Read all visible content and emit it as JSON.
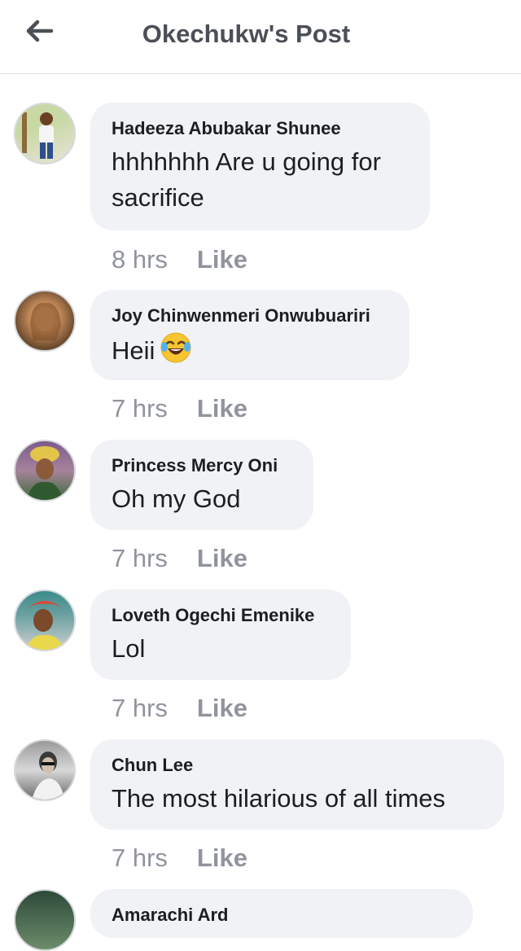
{
  "header": {
    "back_icon": "arrow-left-icon",
    "title": "Okechukw's Post"
  },
  "comments": [
    {
      "author": "Hadeeza Abubakar Shunee",
      "text": "hhhhhhh Are u going for sacrifice",
      "time": "8 hrs",
      "like": "Like",
      "avatar_colors": [
        "#c9d9a6",
        "#e8e3d8"
      ]
    },
    {
      "author": "Joy Chinwenmeri Onwubuariri",
      "text": "Heii",
      "emoji": "face-with-tears-of-joy-icon",
      "time": "7 hrs",
      "like": "Like",
      "avatar_colors": [
        "#6b4a2e",
        "#e9b98a"
      ]
    },
    {
      "author": "Princess Mercy Oni",
      "text": "Oh my God",
      "time": "7 hrs",
      "like": "Like",
      "avatar_colors": [
        "#7b5b8c",
        "#e2c44a"
      ]
    },
    {
      "author": "Loveth Ogechi Emenike",
      "text": "Lol",
      "time": "7 hrs",
      "like": "Like",
      "avatar_colors": [
        "#3b8c8c",
        "#d84a3a"
      ]
    },
    {
      "author": "Chun Lee",
      "text": "The most hilarious of all times",
      "time": "7 hrs",
      "like": "Like",
      "avatar_colors": [
        "#8a8a8a",
        "#e0e0e0"
      ]
    },
    {
      "author": "Amarachi Ard",
      "text": "",
      "time": "",
      "like": "",
      "avatar_colors": [
        "#2d4a3a",
        "#6c8c6a"
      ]
    }
  ]
}
